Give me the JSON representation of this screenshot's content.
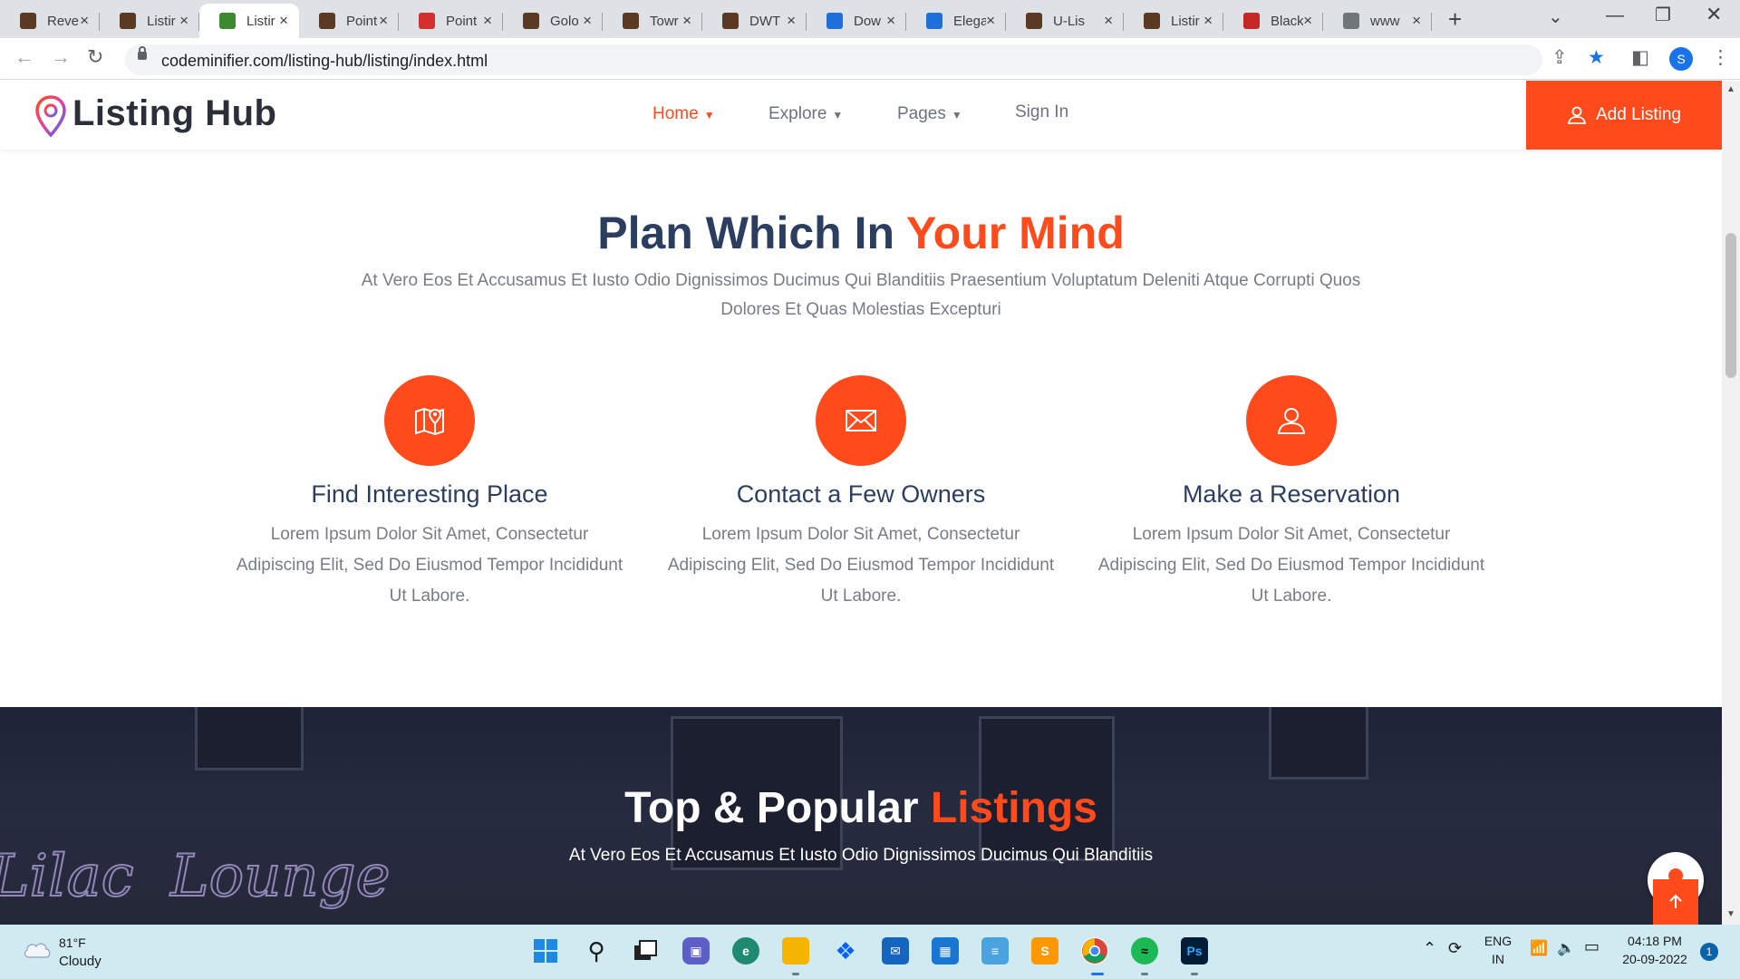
{
  "browser": {
    "tabs": [
      {
        "title": "Reve",
        "color": "#5a3a22"
      },
      {
        "title": "Listir",
        "color": "#5a3a22"
      },
      {
        "title": "Listir",
        "color": "#3c8a2e",
        "active": true
      },
      {
        "title": "Point",
        "color": "#5a3a22"
      },
      {
        "title": "Point",
        "color": "#d32f2f"
      },
      {
        "title": "Golo",
        "color": "#5a3a22"
      },
      {
        "title": "Towr",
        "color": "#5a3a22"
      },
      {
        "title": "DWT",
        "color": "#5a3a22"
      },
      {
        "title": "Dow",
        "color": "#1e6fd9"
      },
      {
        "title": "Elega",
        "color": "#1e6fd9"
      },
      {
        "title": "U-Lis",
        "color": "#5a3a22"
      },
      {
        "title": "Listir",
        "color": "#5a3a22"
      },
      {
        "title": "Black",
        "color": "#c62828"
      },
      {
        "title": "www",
        "color": "#70757a"
      }
    ],
    "url": "codeminifier.com/listing-hub/listing/index.html",
    "profile_initial": "S"
  },
  "site": {
    "logo_text": "Listing Hub",
    "menu": [
      {
        "label": "Home",
        "active": true
      },
      {
        "label": "Explore"
      },
      {
        "label": "Pages"
      },
      {
        "label": "Sign In"
      }
    ],
    "add_listing": "Add Listing",
    "accent_color": "#ff4a1c",
    "heading_color": "#2c3e60"
  },
  "plan": {
    "title_main": "Plan Which In ",
    "title_accent": "Your Mind",
    "subtitle": "At Vero Eos Et Accusamus Et Iusto Odio Dignissimos Ducimus Qui Blanditiis Praesentium Voluptatum Deleniti Atque Corrupti Quos Dolores Et Quas Molestias Excepturi",
    "features": [
      {
        "icon": "map-pin-icon",
        "title": "Find Interesting Place",
        "desc": "Lorem Ipsum Dolor Sit Amet, Consectetur Adipiscing Elit, Sed Do Eiusmod Tempor Incididunt Ut Labore."
      },
      {
        "icon": "envelope-icon",
        "title": "Contact a Few Owners",
        "desc": "Lorem Ipsum Dolor Sit Amet, Consectetur Adipiscing Elit, Sed Do Eiusmod Tempor Incididunt Ut Labore."
      },
      {
        "icon": "user-icon",
        "title": "Make a Reservation",
        "desc": "Lorem Ipsum Dolor Sit Amet, Consectetur Adipiscing Elit, Sed Do Eiusmod Tempor Incididunt Ut Labore."
      }
    ]
  },
  "popular": {
    "title_main": "Top & Popular ",
    "title_accent": "Listings",
    "subtitle": "At Vero Eos Et Accusamus Et Iusto Odio Dignissimos Ducimus Qui Blanditiis",
    "neon_sign": "Lilac Lounge"
  },
  "taskbar": {
    "temperature": "81°F",
    "condition": "Cloudy",
    "language": "ENG",
    "region": "IN",
    "time": "04:18 PM",
    "date": "20-09-2022",
    "notifications": "1",
    "apps": [
      "windows-start",
      "search",
      "task-view",
      "teams",
      "edge",
      "file-explorer",
      "dropbox",
      "mail",
      "store",
      "notepad",
      "sublime-text",
      "chrome",
      "spotify",
      "photoshop"
    ]
  }
}
